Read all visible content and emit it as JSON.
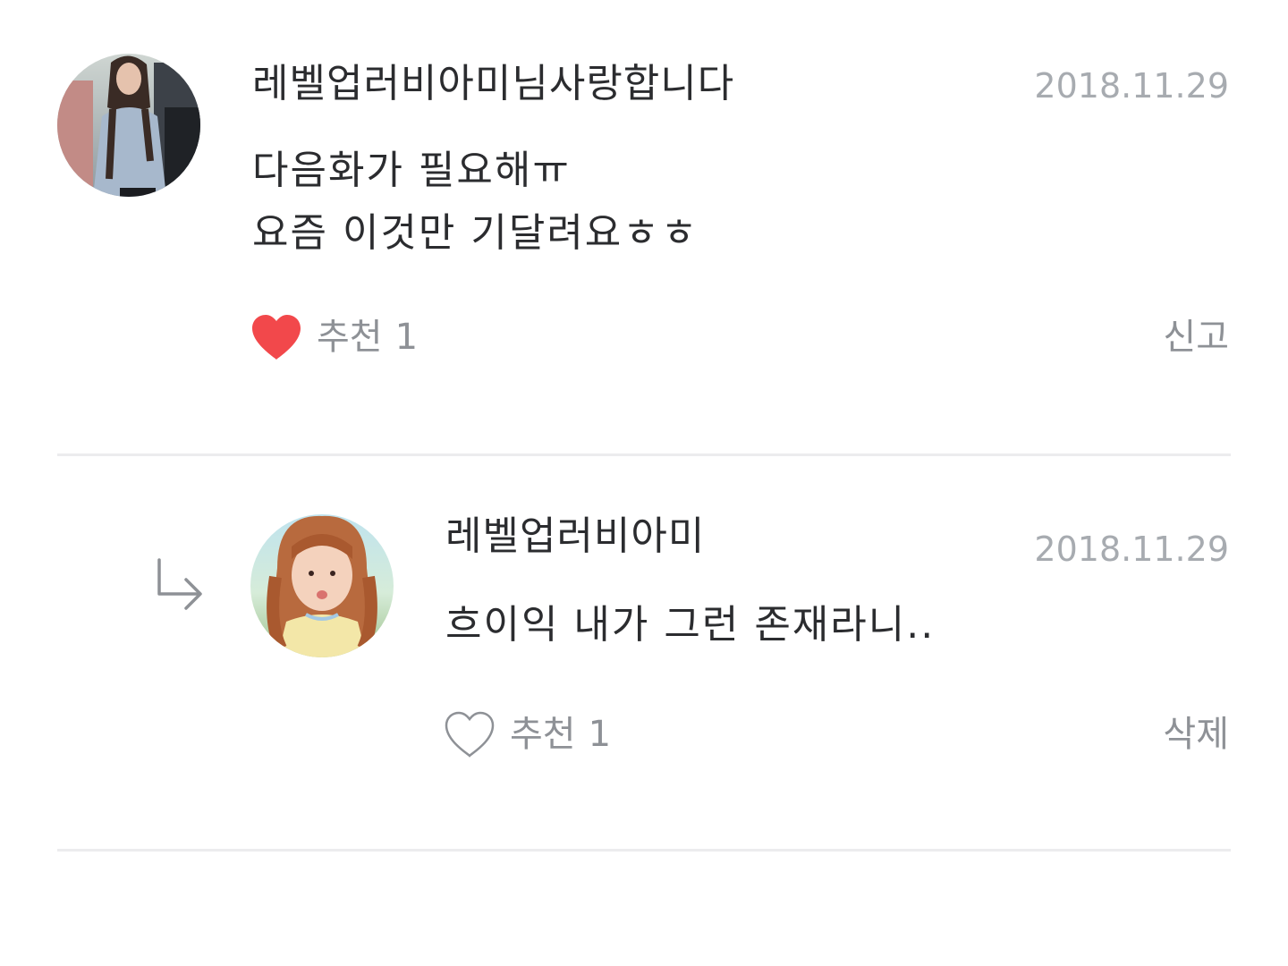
{
  "comments": [
    {
      "author": "레벨업러비아미님사랑합니다",
      "date": "2018.11.29",
      "lines": [
        "다음화가 필요해ㅠ",
        "요즘 이것만 기달려요ㅎㅎ"
      ],
      "like_label": "추천",
      "like_count": "1",
      "liked": true,
      "action_label": "신고"
    },
    {
      "author": "레벨업러비아미",
      "date": "2018.11.29",
      "lines": [
        "흐이익 내가 그런 존재라니.."
      ],
      "like_label": "추천",
      "like_count": "1",
      "liked": false,
      "action_label": "삭제",
      "is_reply": true
    }
  ],
  "icons": {
    "heart_filled": "heart-filled-icon",
    "heart_outline": "heart-outline-icon",
    "reply_arrow": "reply-arrow-icon"
  },
  "colors": {
    "heart_red": "#f2484b",
    "meta_gray": "#a7abb0",
    "text_dark": "#2b2c2f",
    "divider": "#ececee"
  }
}
